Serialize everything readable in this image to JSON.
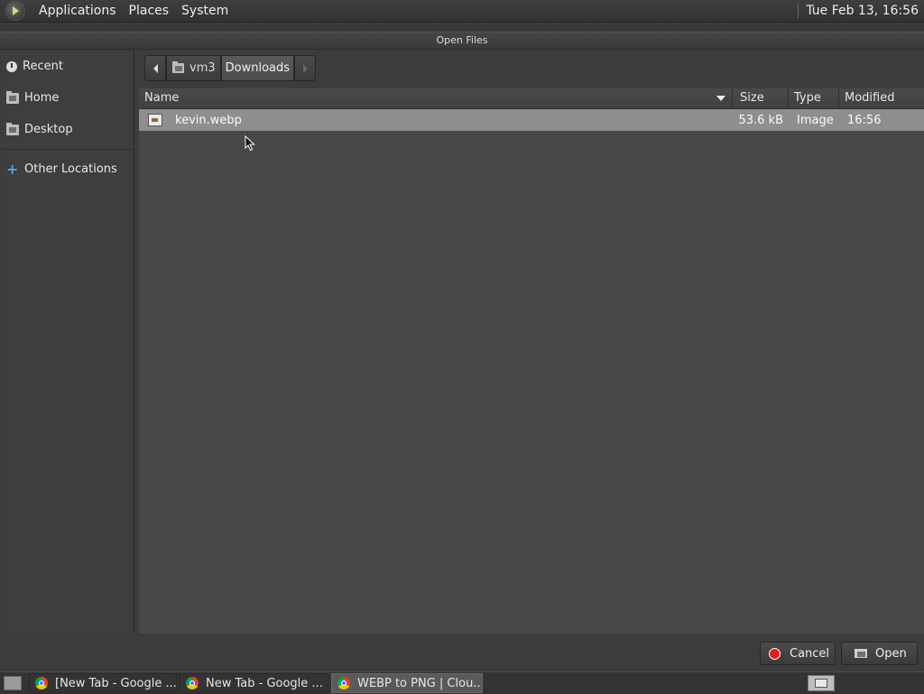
{
  "top_panel": {
    "menus": [
      "Applications",
      "Places",
      "System"
    ],
    "clock": "Tue Feb 13, 16:56"
  },
  "dialog": {
    "title": "Open Files",
    "sidebar": {
      "places": [
        "Recent",
        "Home",
        "Desktop"
      ],
      "other": "Other Locations"
    },
    "path": [
      "vm3",
      "Downloads"
    ],
    "columns": {
      "name": "Name",
      "size": "Size",
      "type": "Type",
      "modified": "Modified"
    },
    "files": [
      {
        "name": "kevin.webp",
        "size": "53.6 kB",
        "type": "Image",
        "modified": "16:56"
      }
    ],
    "buttons": {
      "cancel": "Cancel",
      "open": "Open"
    }
  },
  "taskbar": {
    "tasks": [
      {
        "label": "[New Tab - Google ...",
        "active": false
      },
      {
        "label": "New Tab - Google ...",
        "active": false
      },
      {
        "label": "WEBP to PNG | Clou...",
        "active": true
      }
    ]
  },
  "icons": {
    "os_logo": "os-logo-icon",
    "recent": "clock-icon",
    "folder": "folder-icon",
    "other_locations": "plus-icon",
    "file": "image-file-icon",
    "cancel": "stop-icon",
    "open": "folder-open-icon",
    "browser": "chrome-icon"
  },
  "colors": {
    "selected_row": "#8e8e8e",
    "cancel_icon": "#e02020",
    "other_locations_icon": "#5aa0e8"
  }
}
